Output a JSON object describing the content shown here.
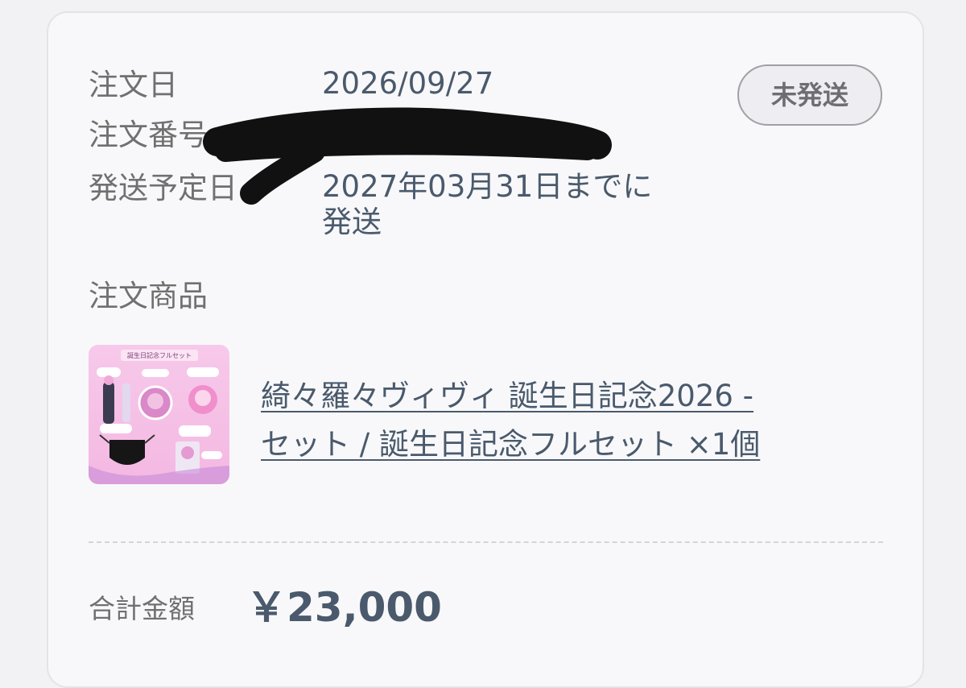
{
  "order": {
    "date_label": "注文日",
    "date_value": "2026/09/27",
    "number_label": "注文番号",
    "ship_label": "発送予定日",
    "ship_value_line1": "2027年03月31日までに",
    "ship_value_line2": "発送",
    "status": "未発送"
  },
  "items": {
    "section_label": "注文商品",
    "product_line1": "綺々羅々ヴィヴィ 誕生日記念2026 -",
    "product_line2": "セット / 誕生日記念フルセット ×1個",
    "thumbnail_caption": "誕生日記念フルセット"
  },
  "summary": {
    "total_label": "合計金額",
    "total_value": "￥23,000"
  }
}
